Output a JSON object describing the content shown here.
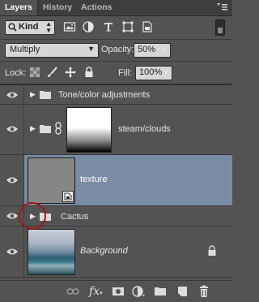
{
  "tabs": [
    {
      "label": "Layers",
      "active": true
    },
    {
      "label": "History",
      "active": false
    },
    {
      "label": "Actions",
      "active": false
    }
  ],
  "filter": {
    "kind_label": "Kind",
    "icons": [
      "image-filter-icon",
      "adjustment-filter-icon",
      "type-filter-icon",
      "shape-filter-icon",
      "smart-object-filter-icon"
    ]
  },
  "blend": {
    "mode": "Multiply",
    "opacity_label": "Opacity:",
    "opacity_value": "50%"
  },
  "lock": {
    "label": "Lock:",
    "fill_label": "Fill:",
    "fill_value": "100%"
  },
  "layers": [
    {
      "name": "Tone/color adjustments",
      "type": "group",
      "visible": true,
      "selected": false
    },
    {
      "name": "steam/clouds",
      "type": "group-masked",
      "visible": true,
      "selected": false
    },
    {
      "name": "texture",
      "type": "smart-object",
      "visible": true,
      "selected": true
    },
    {
      "name": "Cactus",
      "type": "group",
      "visible": false,
      "selected": false
    },
    {
      "name": "Background",
      "type": "background",
      "visible": true,
      "selected": false,
      "locked": true
    }
  ],
  "colors": {
    "panel": "#535353",
    "selected": "#7a8ba4",
    "highlight_circle": "#a01818"
  }
}
